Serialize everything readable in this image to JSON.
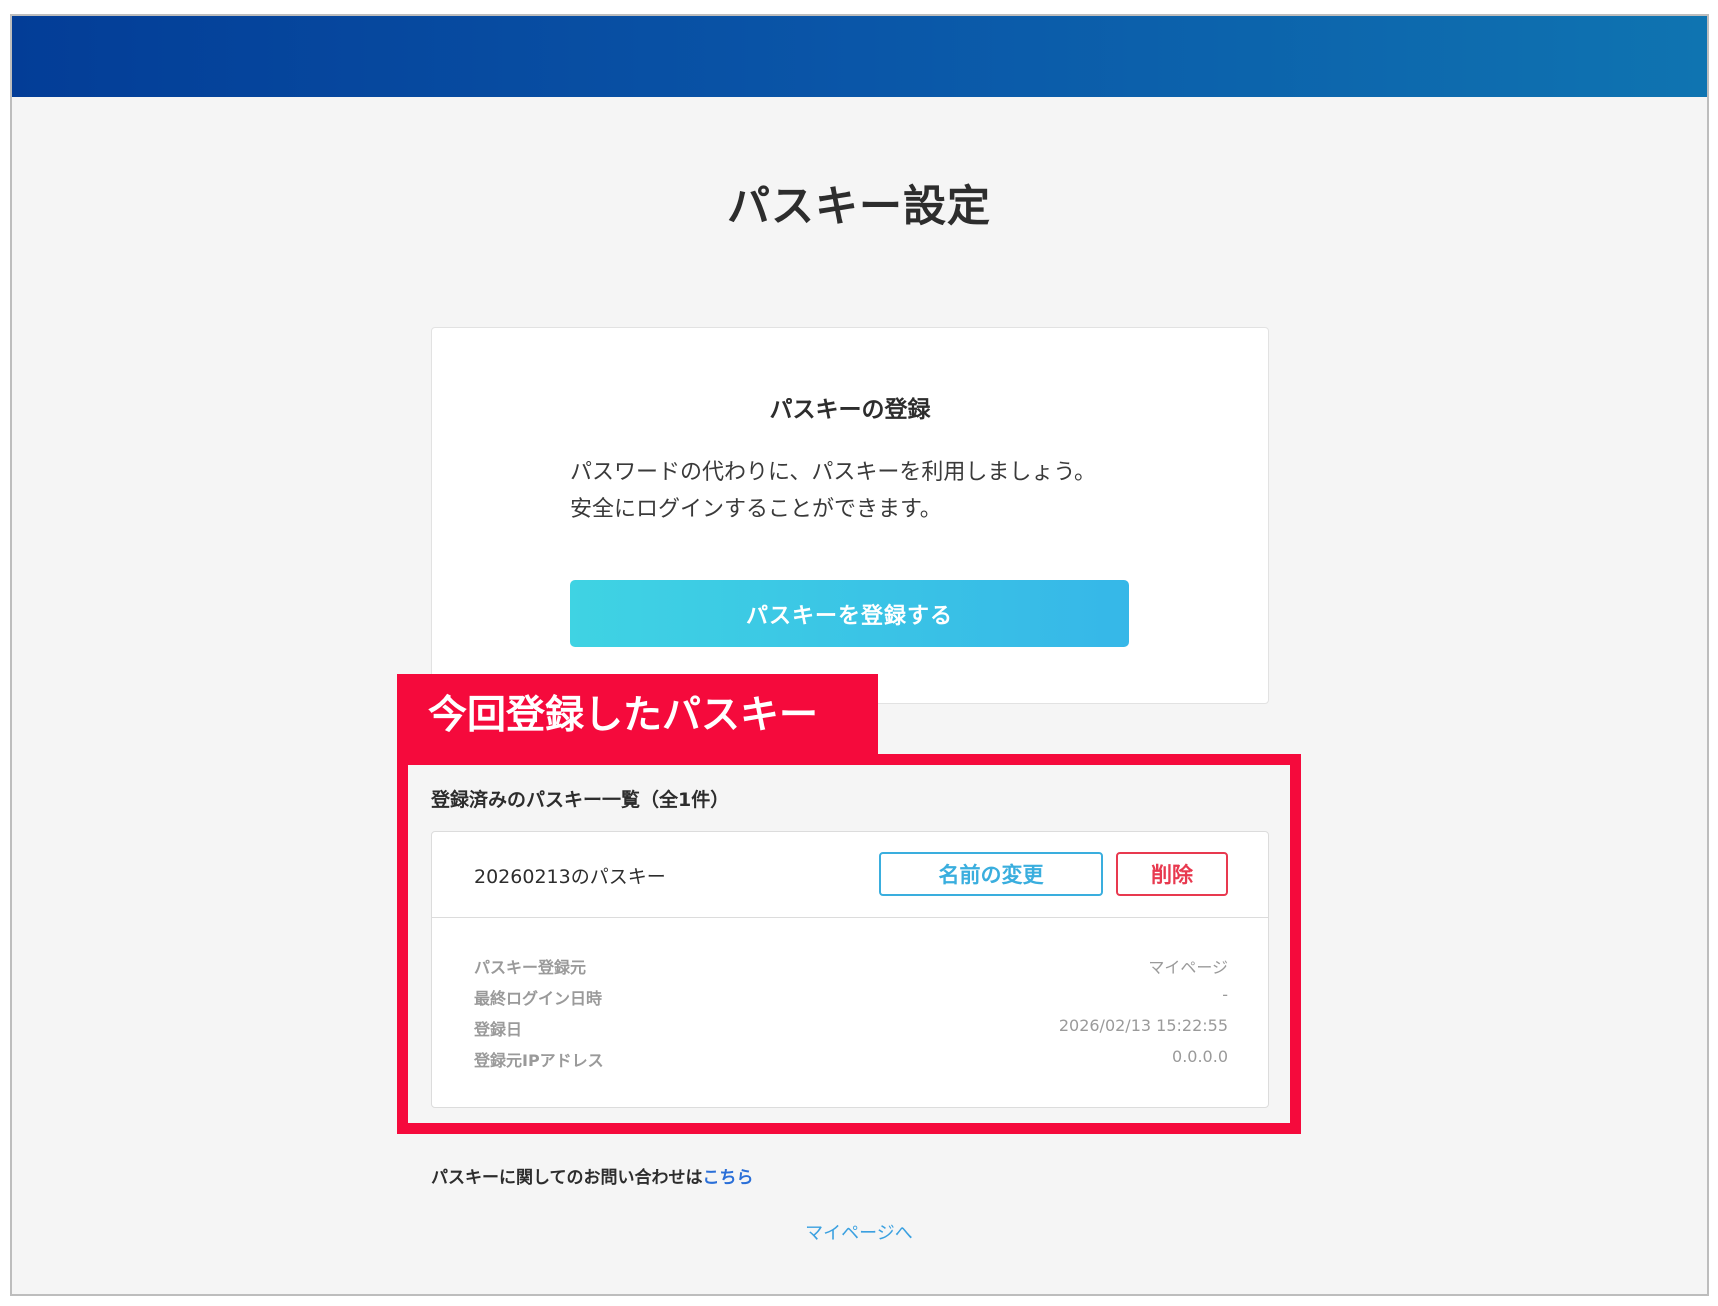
{
  "page": {
    "title": "パスキー設定"
  },
  "registration": {
    "title": "パスキーの登録",
    "description_line1": "パスワードの代わりに、パスキーを利用しましょう。",
    "description_line2": "安全にログインすることができます。",
    "button_label": "パスキーを登録する"
  },
  "annotation": {
    "label": "今回登録したパスキー",
    "color": "#f50a3c"
  },
  "passkey_list": {
    "heading": "登録済みのパスキー一覧（全1件）",
    "items": [
      {
        "name": "20260213のパスキー",
        "rename_label": "名前の変更",
        "delete_label": "削除",
        "details": [
          {
            "label": "パスキー登録元",
            "value": "マイページ"
          },
          {
            "label": "最終ログイン日時",
            "value": "-"
          },
          {
            "label": "登録日",
            "value": "2026/02/13 15:22:55"
          },
          {
            "label": "登録元IPアドレス",
            "value": "0.0.0.0"
          }
        ]
      }
    ]
  },
  "footer": {
    "inquiry_text": "パスキーに関してのお問い合わせは",
    "inquiry_link": "こちら",
    "mypage_link": "マイページへ"
  },
  "colors": {
    "header_gradient_start": "#033d97",
    "header_gradient_end": "#0f74b1",
    "primary_button": "#36b7e8",
    "rename_button": "#3aaede",
    "delete_button": "#e8394f",
    "link": "#2a6fd8"
  }
}
